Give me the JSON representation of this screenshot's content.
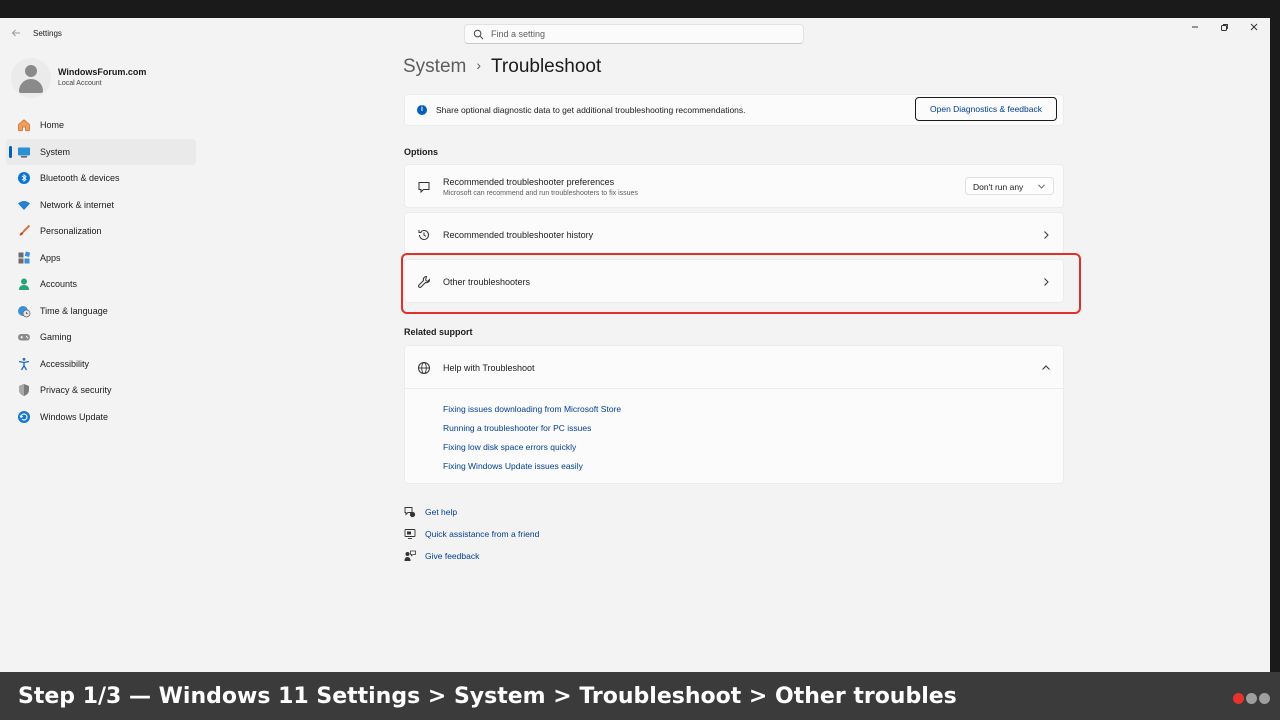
{
  "window": {
    "app_title": "Settings",
    "back_icon": "back-arrow-icon",
    "search_placeholder": "Find a setting",
    "controls": [
      "minimize-icon",
      "maximize-icon",
      "close-icon"
    ]
  },
  "profile": {
    "name": "WindowsForum.com",
    "account_type": "Local Account"
  },
  "sidebar": {
    "items": [
      {
        "label": "Home",
        "icon": "home-icon",
        "active": false
      },
      {
        "label": "System",
        "icon": "system-icon",
        "active": true
      },
      {
        "label": "Bluetooth & devices",
        "icon": "bluetooth-icon",
        "active": false
      },
      {
        "label": "Network & internet",
        "icon": "wifi-icon",
        "active": false
      },
      {
        "label": "Personalization",
        "icon": "brush-icon",
        "active": false
      },
      {
        "label": "Apps",
        "icon": "apps-icon",
        "active": false
      },
      {
        "label": "Accounts",
        "icon": "accounts-icon",
        "active": false
      },
      {
        "label": "Time & language",
        "icon": "globe-clock-icon",
        "active": false
      },
      {
        "label": "Gaming",
        "icon": "gamepad-icon",
        "active": false
      },
      {
        "label": "Accessibility",
        "icon": "accessibility-icon",
        "active": false
      },
      {
        "label": "Privacy & security",
        "icon": "shield-icon",
        "active": false
      },
      {
        "label": "Windows Update",
        "icon": "update-icon",
        "active": false
      }
    ]
  },
  "breadcrumb": {
    "parent": "System",
    "separator": "›",
    "current": "Troubleshoot"
  },
  "info_bar": {
    "text": "Share optional diagnostic data to get additional troubleshooting recommendations.",
    "button_label": "Open Diagnostics & feedback"
  },
  "options": {
    "section_title": "Options",
    "preferences": {
      "title": "Recommended troubleshooter preferences",
      "subtitle": "Microsoft can recommend and run troubleshooters to fix issues",
      "dropdown_value": "Don't run any"
    },
    "history": {
      "title": "Recommended troubleshooter history"
    },
    "other": {
      "title": "Other troubleshooters",
      "highlighted": true
    }
  },
  "related_support": {
    "section_title": "Related support",
    "help_title": "Help with Troubleshoot",
    "links": [
      "Fixing issues downloading from Microsoft Store",
      "Running a troubleshooter for PC issues",
      "Fixing low disk space errors quickly",
      "Fixing Windows Update issues easily"
    ]
  },
  "footer_links": [
    {
      "label": "Get help",
      "icon": "get-help-icon"
    },
    {
      "label": "Quick assistance from a friend",
      "icon": "quick-assist-icon"
    },
    {
      "label": "Give feedback",
      "icon": "feedback-icon"
    }
  ],
  "caption": {
    "text": "Step 1/3 — Windows 11 Settings > System > Troubleshoot > Other troubles",
    "dot_colors": [
      "#e8322c",
      "#9e9e9e",
      "#9e9e9e"
    ]
  },
  "colors": {
    "accent": "#005fb8",
    "link": "#003e92",
    "highlight_border": "#e0302a",
    "window_bg": "#f3f3f3"
  }
}
